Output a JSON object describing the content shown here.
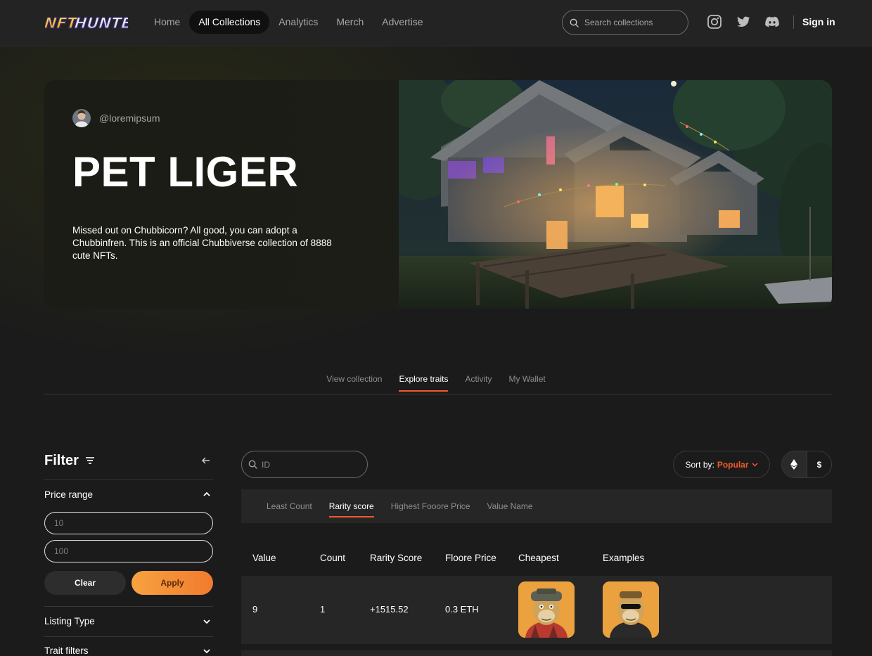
{
  "header": {
    "logo_text": "NFTHUNTERZ",
    "nav": [
      {
        "label": "Home"
      },
      {
        "label": "All Collections",
        "active": true
      },
      {
        "label": "Analytics"
      },
      {
        "label": "Merch"
      },
      {
        "label": "Advertise"
      }
    ],
    "search_placeholder": "Search collections",
    "social_icons": [
      "instagram-icon",
      "twitter-icon",
      "discord-icon"
    ],
    "signin_label": "Sign in"
  },
  "hero": {
    "creator_handle": "@loremipsum",
    "title": "PET LIGER",
    "description": "Missed out on Chubbicorn? All good, you can adopt a Chubbinfren. This is an official Chubbiverse collection of 8888 cute NFTs."
  },
  "tabs": [
    {
      "label": "View collection"
    },
    {
      "label": "Explore traits",
      "active": true
    },
    {
      "label": "Activity"
    },
    {
      "label": "My Wallet"
    }
  ],
  "filter": {
    "title": "Filter",
    "price_range_label": "Price range",
    "min_placeholder": "10",
    "max_placeholder": "100",
    "clear_label": "Clear",
    "apply_label": "Apply",
    "listing_type_label": "Listing Type",
    "trait_filters_label": "Trait filters"
  },
  "main": {
    "id_placeholder": "ID",
    "sort_label": "Sort by:",
    "sort_value": "Popular",
    "currency_options": [
      "ETH",
      "$"
    ],
    "subtabs": [
      {
        "label": "Least Count"
      },
      {
        "label": "Rarity score",
        "active": true
      },
      {
        "label": "Highest Fooore Price"
      },
      {
        "label": "Value Name"
      }
    ],
    "columns": [
      "Value",
      "Count",
      "Rarity Score",
      "Floore Price",
      "Cheapest",
      "Examples"
    ],
    "rows": [
      {
        "value": "9",
        "count": "1",
        "rarity_score": "+1515.52",
        "floor_price": "0.3 ETH"
      }
    ]
  },
  "colors": {
    "accent": "#f05a28",
    "apply_gradient_start": "#f7a340",
    "apply_gradient_end": "#f17a2f",
    "background": "#1b1b1b",
    "panel": "#262626"
  }
}
